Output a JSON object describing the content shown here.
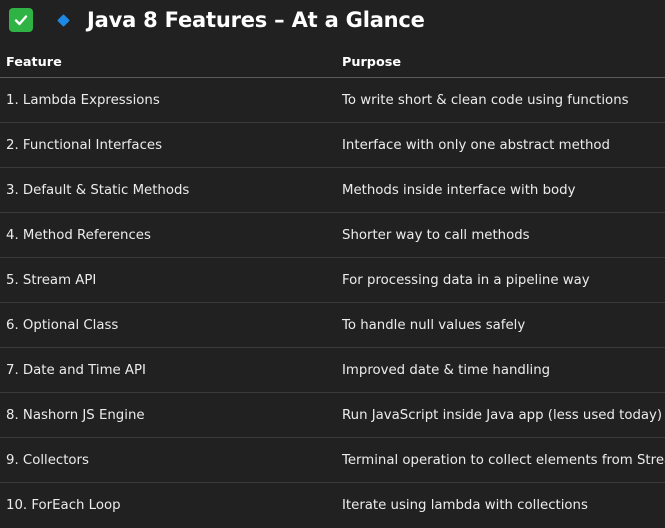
{
  "heading": {
    "title": "Java 8 Features – At a Glance",
    "check_color": "#2fb344",
    "bullet_color": "#1e88e5"
  },
  "table": {
    "columns": [
      "Feature",
      "Purpose"
    ],
    "rows": [
      {
        "feature": "1. Lambda Expressions",
        "purpose": "To write short & clean code using functions"
      },
      {
        "feature": "2. Functional Interfaces",
        "purpose": "Interface with only one abstract method"
      },
      {
        "feature": "3. Default & Static Methods",
        "purpose": "Methods inside interface with body"
      },
      {
        "feature": "4. Method References",
        "purpose": "Shorter way to call methods"
      },
      {
        "feature": "5. Stream API",
        "purpose": "For processing data in a pipeline way"
      },
      {
        "feature": "6. Optional Class",
        "purpose": "To handle null values safely"
      },
      {
        "feature": "7. Date and Time API",
        "purpose": "Improved date & time handling"
      },
      {
        "feature": "8. Nashorn JS Engine",
        "purpose": "Run JavaScript inside Java app (less used today)"
      },
      {
        "feature": "9. Collectors",
        "purpose": "Terminal operation to collect elements from Stream"
      },
      {
        "feature": "10. ForEach Loop",
        "purpose": "Iterate using lambda with collections"
      }
    ]
  }
}
